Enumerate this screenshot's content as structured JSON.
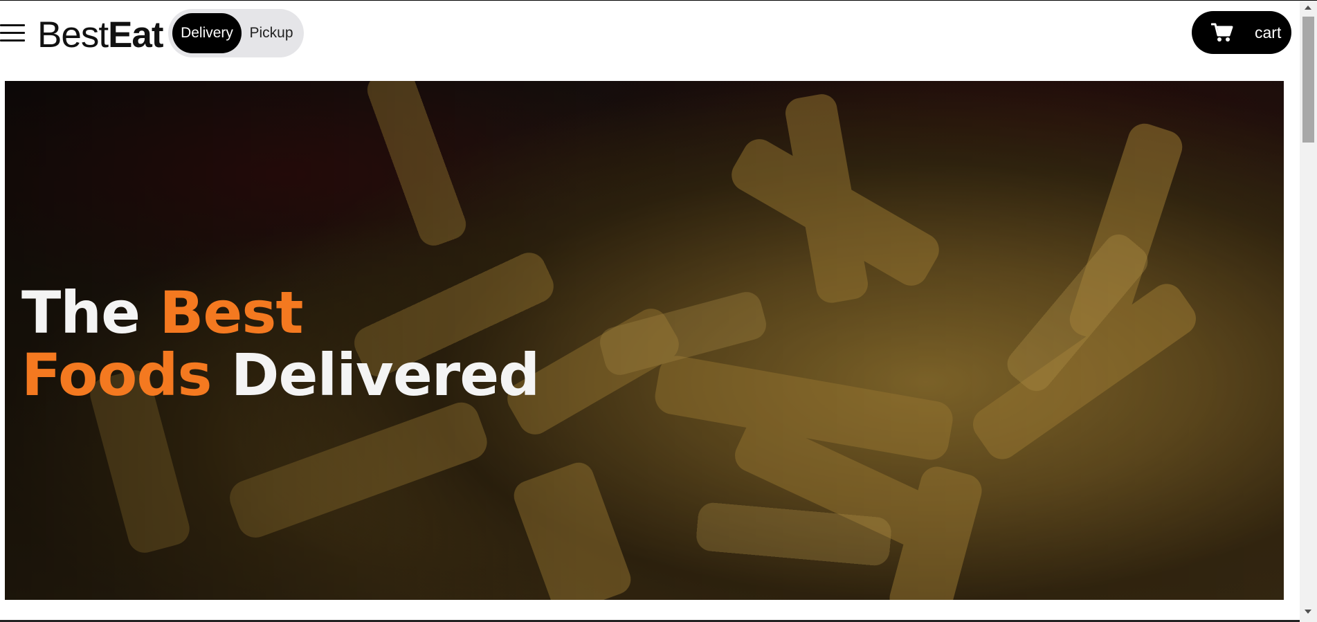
{
  "header": {
    "menu_icon": "hamburger-menu-icon",
    "logo": {
      "light": "Best",
      "bold": "Eat"
    },
    "mode_toggle": {
      "options": [
        "Delivery",
        "Pickup"
      ],
      "selected": "Delivery"
    },
    "cart": {
      "label": "cart",
      "icon": "shopping-cart-icon"
    }
  },
  "hero": {
    "line1_white": "The ",
    "line1_accent": "Best",
    "line2_accent": "Foods",
    "line2_white": " Delivered",
    "background": "french-fries-photo"
  },
  "colors": {
    "accent": "#f47920",
    "primary_button": "#000000",
    "toggle_bg": "#e5e5e8",
    "hero_text": "#f4f4f4"
  }
}
